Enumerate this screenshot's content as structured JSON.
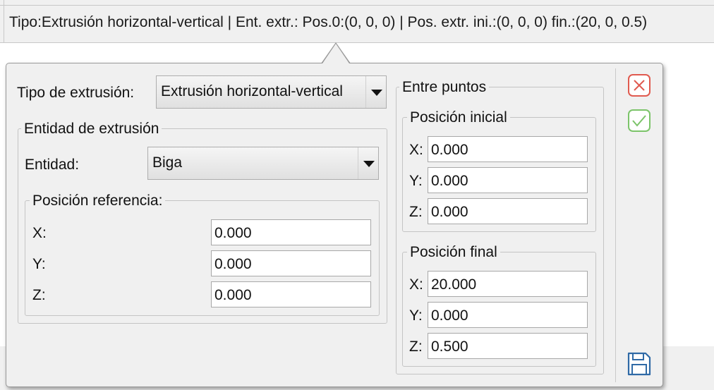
{
  "status_bar": {
    "text": "Tipo:Extrusión horizontal-vertical | Ent. extr.: Pos.0:(0, 0, 0) | Pos. extr. ini.:(0, 0, 0) fin.:(20, 0, 0.5)"
  },
  "dialog": {
    "extrusion_type_label": "Tipo de extrusión:",
    "extrusion_type_value": "Extrusión horizontal-vertical",
    "entity_group": {
      "title": "Entidad de extrusión",
      "entity_label": "Entidad:",
      "entity_value": "Biga",
      "ref_group": {
        "title": "Posición referencia:",
        "x_label": "X:",
        "x_value": "0.000",
        "y_label": "Y:",
        "y_value": "0.000",
        "z_label": "Z:",
        "z_value": "0.000"
      }
    },
    "between_points": {
      "title": "Entre puntos",
      "initial": {
        "title": "Posición inicial",
        "x_label": "X:",
        "x_value": "0.000",
        "y_label": "Y:",
        "y_value": "0.000",
        "z_label": "Z:",
        "z_value": "0.000"
      },
      "final": {
        "title": "Posición final",
        "x_label": "X:",
        "x_value": "20.000",
        "y_label": "Y:",
        "y_value": "0.000",
        "z_label": "Z:",
        "z_value": "0.500"
      }
    },
    "actions": {
      "cancel_icon": "close-icon",
      "accept_icon": "check-icon",
      "save_icon": "save-icon",
      "cancel_color": "#e05a4f",
      "accept_color": "#7cc46a",
      "save_color": "#2f6aa6"
    }
  }
}
